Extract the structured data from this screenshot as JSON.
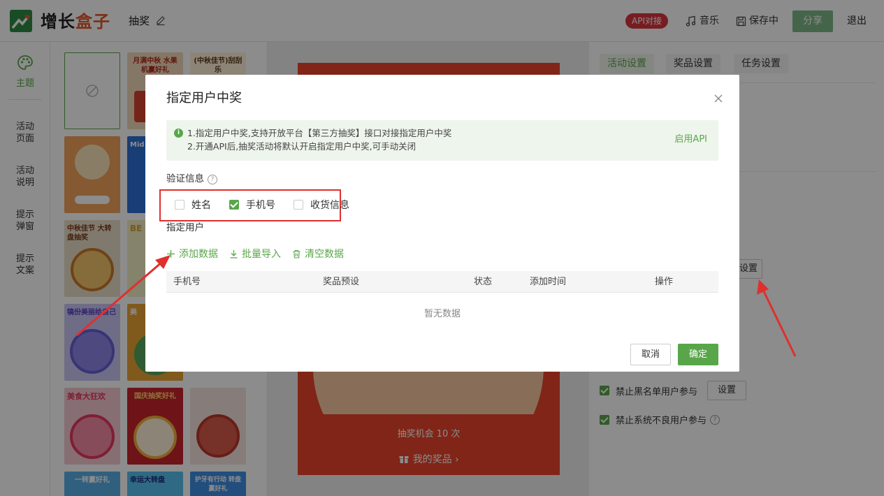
{
  "header": {
    "brand_part1": "增长",
    "brand_part2": "盒子",
    "doc_title": "抽奖",
    "api_badge": "API对接",
    "music": "音乐",
    "saving": "保存中",
    "share": "分享",
    "exit": "退出"
  },
  "sidebar": {
    "items": [
      {
        "label": "主题",
        "active": true
      },
      {
        "label": "活动页面"
      },
      {
        "label": "活动说明"
      },
      {
        "label": "提示弹窗"
      },
      {
        "label": "提示文案"
      }
    ]
  },
  "templates": {
    "labels": [
      "月满中秋 水果机赢好礼",
      "(中秋佳节)刮刮乐",
      "Mid 水果",
      "中秋佳节 大转盘抽奖",
      "BE",
      "犒份美丽给自己",
      "美",
      "美食大狂欢",
      "国庆抽奖好礼",
      "一转赢好礼",
      "幸运大转盘",
      "护牙有行动 转盘赢好礼"
    ]
  },
  "canvas": {
    "chance_text": "抽奖机会 10 次",
    "my_prizes": "我的奖品"
  },
  "right_panel": {
    "tabs": [
      "活动设置",
      "奖品设置",
      "任务设置"
    ],
    "partial_button": "设置",
    "blacklist_label": "禁止黑名单用户参与",
    "blacklist_button": "设置",
    "bad_users_label": "禁止系统不良用户参与"
  },
  "dialog": {
    "title": "指定用户中奖",
    "notice_line1": "1.指定用户中奖,支持开放平台【第三方抽奖】接口对接指定用户中奖",
    "notice_line2": "2.开通API后,抽奖活动将默认开启指定用户中奖,可手动关闭",
    "notice_link": "启用API",
    "verify_label": "验证信息",
    "verify_options": [
      {
        "label": "姓名",
        "checked": false
      },
      {
        "label": "手机号",
        "checked": true
      },
      {
        "label": "收货信息",
        "checked": false
      }
    ],
    "users_label": "指定用户",
    "actions": {
      "add": "添加数据",
      "import": "批量导入",
      "clear": "清空数据"
    },
    "columns": [
      "手机号",
      "奖品预设",
      "状态",
      "添加时间",
      "操作"
    ],
    "empty_text": "暂无数据",
    "cancel": "取消",
    "confirm": "确定"
  },
  "colors": {
    "accent_green": "#59a64a",
    "brand_orange": "#e2572b",
    "badge_red": "#d9363e",
    "annotation_red": "#e02f2f"
  },
  "icons": [
    "logo-icon",
    "pen-icon",
    "music-icon",
    "save-icon",
    "palette-icon",
    "close-icon",
    "info-icon",
    "help-icon",
    "plus-icon",
    "download-icon",
    "trash-icon",
    "gift-icon",
    "chevron-right-icon",
    "no-template-icon"
  ]
}
